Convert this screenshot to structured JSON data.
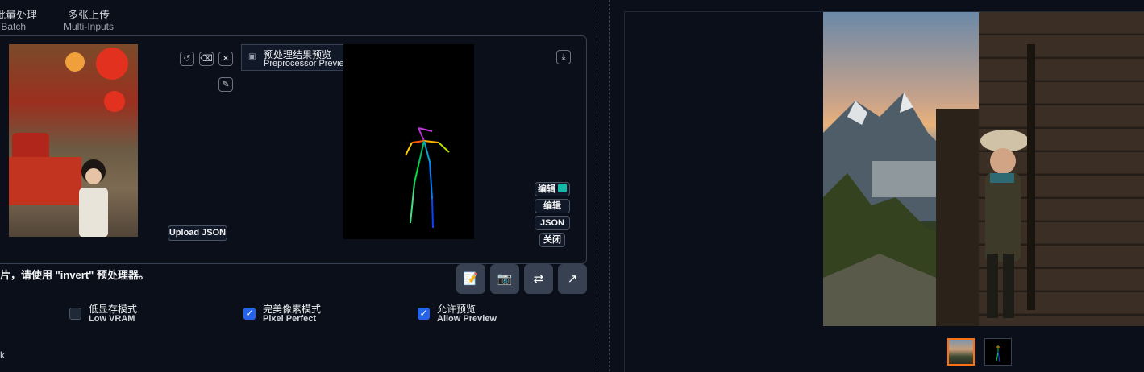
{
  "tabs": [
    {
      "zh": "批量处理",
      "en": "Batch"
    },
    {
      "zh": "多张上传",
      "en": "Multi-Inputs"
    }
  ],
  "image_tools": {
    "undo_icon": "undo-icon",
    "eraser_icon": "eraser-icon",
    "close_icon": "close-icon",
    "brush_icon": "brush-icon"
  },
  "upload_json_label": "Upload JSON",
  "preview": {
    "zh": "预处理结果预览",
    "en": "Preprocessor Preview",
    "download_icon": "download-icon"
  },
  "pose_buttons": {
    "edit_ext": "编辑",
    "edit": "编辑",
    "json": "JSON",
    "close": "关闭"
  },
  "hint_text": "片，请使用 \"invert\" 预处理器。",
  "toolbar_icons": [
    "edit-doc-icon",
    "camera-icon",
    "swap-icon",
    "send-arrow-icon"
  ],
  "toolbar_glyphs": [
    "📝",
    "📷",
    "⇄",
    "↗"
  ],
  "checkboxes": [
    {
      "zh": "低显存模式",
      "en": "Low VRAM",
      "checked": false
    },
    {
      "zh": "完美像素模式",
      "en": "Pixel Perfect",
      "checked": true
    },
    {
      "zh": "允许预览",
      "en": "Allow Preview",
      "checked": true
    }
  ],
  "bottom_fragment": "k",
  "gallery": {
    "selected_index": 0,
    "thumb_count": 2
  },
  "colors": {
    "background": "#0b0f19",
    "accent": "#2563eb",
    "selected_thumb": "#f97316"
  }
}
